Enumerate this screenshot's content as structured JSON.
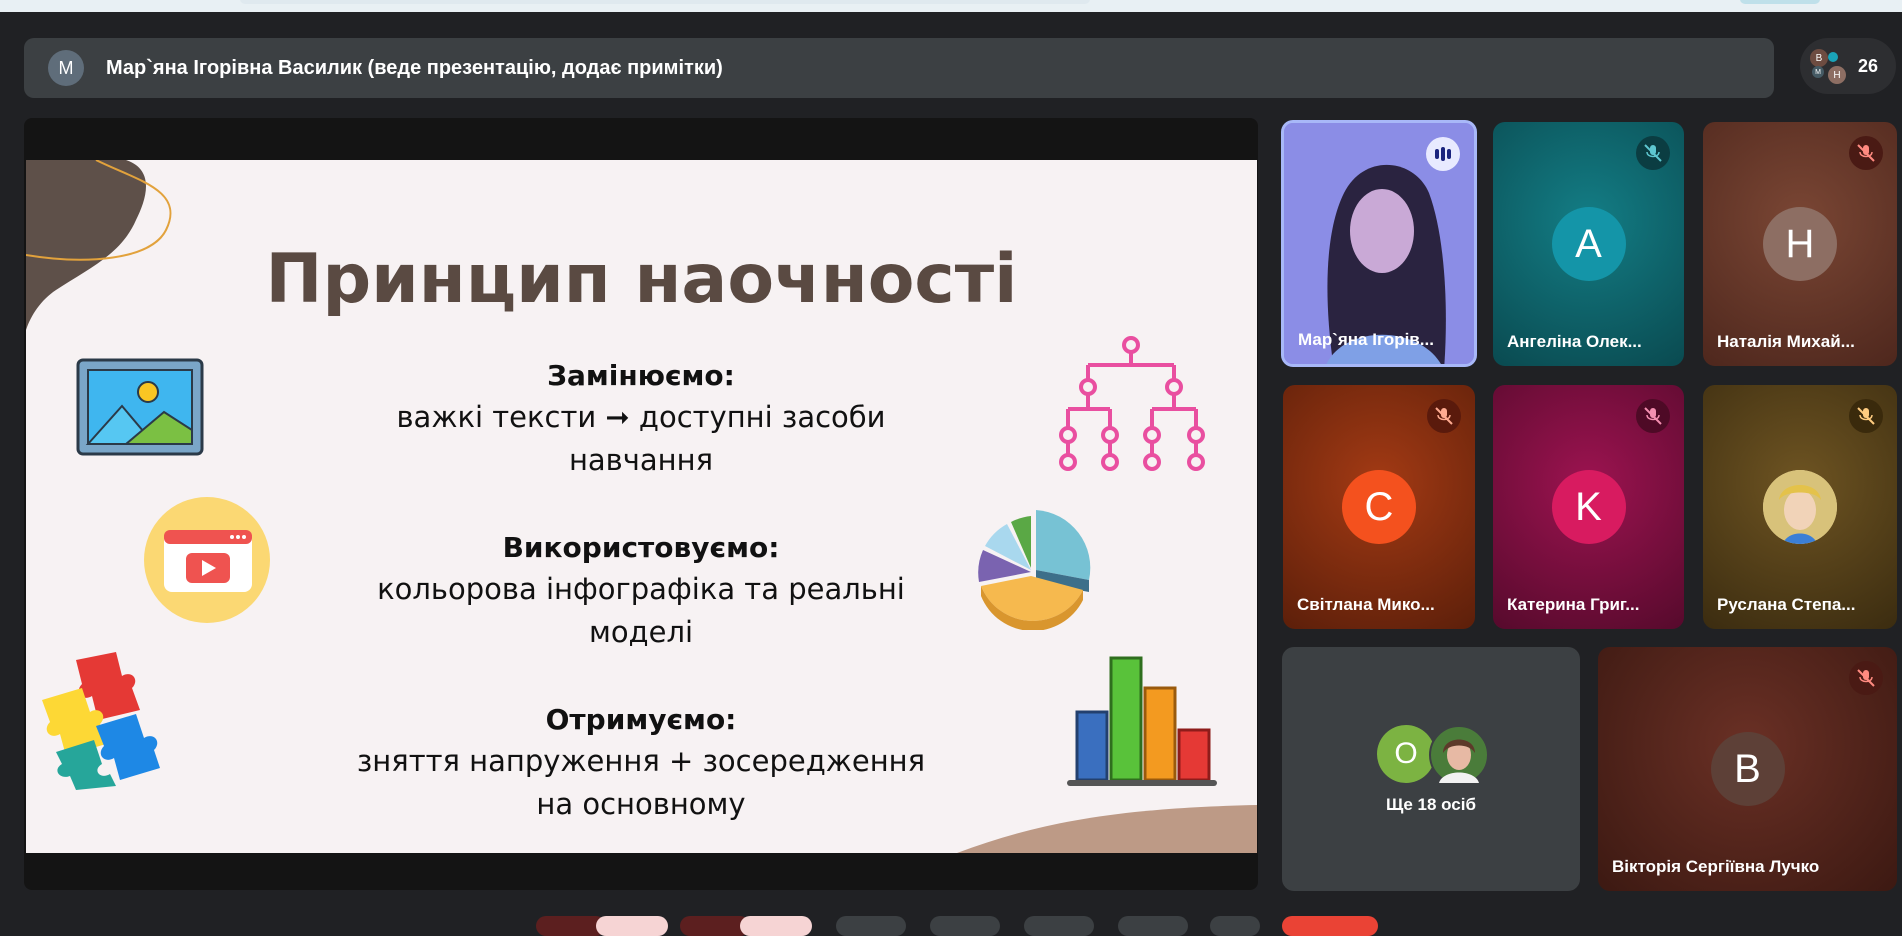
{
  "presenter": {
    "avatar_letter": "M",
    "label": "Мар`яна Ігорівна Василик (веде презентацію, додає примітки)"
  },
  "people": {
    "count": "26",
    "mini_avatars": [
      "B",
      "M",
      "H"
    ]
  },
  "slide": {
    "title": "Принцип наочності",
    "sections": [
      {
        "heading": "Замінюємо:",
        "lines": [
          "важкі тексти ➞ доступні засоби",
          "навчання"
        ]
      },
      {
        "heading": "Використовуємо:",
        "lines": [
          "кольорова інфографіка та реальні",
          "моделі"
        ]
      },
      {
        "heading": "Отримуємо:",
        "lines": [
          "зняття напруження + зосередження",
          "на основному"
        ]
      }
    ]
  },
  "participants": [
    {
      "name": "Мар`яна Ігорів...",
      "type": "video",
      "speaking": true
    },
    {
      "name": "Ангеліна Олек...",
      "avatar_letter": "A",
      "bg": "#0f6a72",
      "avatar_color": "#1495a8",
      "muted": true
    },
    {
      "name": "Наталія Михай...",
      "avatar_letter": "H",
      "bg": "#6b3a2c",
      "avatar_color": "#8d6e63",
      "muted": true
    },
    {
      "name": "Світлана Мико...",
      "avatar_letter": "C",
      "bg": "#8a2f12",
      "avatar_color": "#f4511e",
      "muted": true
    },
    {
      "name": "Катерина Григ...",
      "avatar_letter": "K",
      "bg": "#7c1040",
      "avatar_color": "#d81b60",
      "muted": true
    },
    {
      "name": "Руслана Степа...",
      "type": "photo",
      "bg": "#5a4318",
      "muted": true
    },
    {
      "name": "Вікторія Сергіївна Лучко",
      "avatar_letter": "B",
      "bg": "#5c2b22",
      "avatar_color": "#5d4037",
      "muted": true
    }
  ],
  "more": {
    "label": "Ще 18 осіб",
    "avatar_letter": "O"
  },
  "colors": {
    "background": "#202124",
    "bar": "#3c4043",
    "speaking_border": "#a8b8f8",
    "muted_mic": "#ea4335",
    "slide_title": "#5a4a42"
  }
}
